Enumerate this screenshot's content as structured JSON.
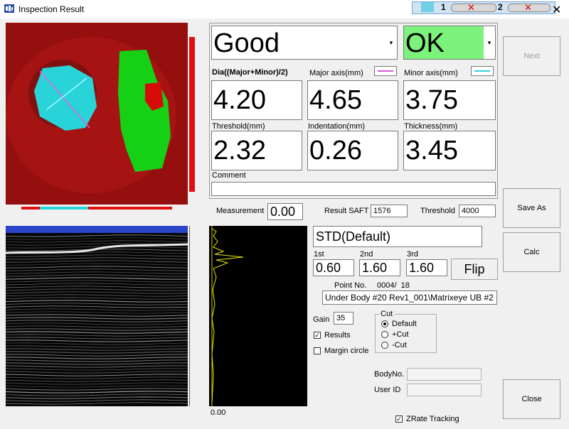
{
  "window": {
    "title": "Inspection Result",
    "close_glyph": "✕"
  },
  "mini_tabs": [
    {
      "num": "1"
    },
    {
      "num": "2"
    }
  ],
  "result": {
    "verdict": "Good",
    "status": "OK",
    "status_color": "#7cf27c"
  },
  "measurements": {
    "dia_label": "Dia((Major+Minor)/2)",
    "dia_value": "4.20",
    "major_label": "Major axis(mm)",
    "major_value": "4.65",
    "major_color": "#d85ad8",
    "minor_label": "Minor axis(mm)",
    "minor_value": "3.75",
    "minor_color": "#33d6e6",
    "threshold_label": "Threshold(mm)",
    "threshold_value": "2.32",
    "indentation_label": "Indentation(mm)",
    "indentation_value": "0.26",
    "thickness_label": "Thickness(mm)",
    "thickness_value": "3.45",
    "comment_label": "Comment",
    "comment_value": ""
  },
  "scan": {
    "measurement_label": "Measurement",
    "measurement_value": "0.00",
    "saft_label": "Result SAFT",
    "saft_value": "1576",
    "threshold_label": "Threshold",
    "threshold_value": "4000",
    "profile": "STD(Default)",
    "first_label": "1st",
    "first_value": "0.60",
    "second_label": "2nd",
    "second_value": "1.60",
    "third_label": "3rd",
    "third_value": "1.60",
    "flip_label": "Flip",
    "point_label": "Point No.",
    "point_value": "0004/  18",
    "path": "Under Body #20 Rev1_001\\Matrixeye UB #2",
    "gain_label": "Gain",
    "gain_value": "35",
    "results_label": "Results",
    "results_checked": true,
    "margin_label": "Margin circle",
    "margin_checked": false,
    "cut_label": "Cut",
    "cut_options": [
      "Default",
      "+Cut",
      "-Cut"
    ],
    "cut_selected": "Default",
    "body_label": "BodyNo.",
    "body_value": "",
    "user_label": "User ID",
    "user_value": "",
    "zrate_label": "ZRate Tracking",
    "zrate_checked": true,
    "ascan_value": "0.00"
  },
  "buttons": {
    "next": "Next",
    "save_as": "Save As",
    "calc": "Calc",
    "close": "Close"
  }
}
